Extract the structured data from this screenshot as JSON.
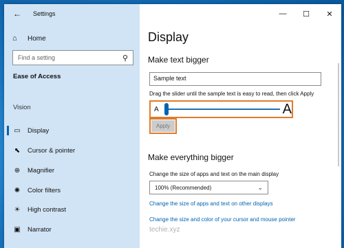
{
  "window": {
    "title": "Settings"
  },
  "controls": {
    "minimize": "—",
    "maximize": "☐",
    "close": "✕"
  },
  "sidebar": {
    "back_icon": "←",
    "home_label": "Home",
    "home_icon": "⌂",
    "search_placeholder": "Find a setting",
    "search_icon": "⚲",
    "section": "Ease of Access",
    "group": "Vision",
    "items": [
      {
        "label": "Display",
        "icon": "▭",
        "selected": true
      },
      {
        "label": "Cursor & pointer",
        "icon": "⬉"
      },
      {
        "label": "Magnifier",
        "icon": "⊕"
      },
      {
        "label": "Color filters",
        "icon": "✺"
      },
      {
        "label": "High contrast",
        "icon": "☀"
      },
      {
        "label": "Narrator",
        "icon": "▣"
      }
    ]
  },
  "main": {
    "title": "Display",
    "text_bigger": {
      "heading": "Make text bigger",
      "sample_value": "Sample text",
      "hint": "Drag the slider until the sample text is easy to read, then click Apply",
      "slider_min_label": "A",
      "slider_max_label": "A",
      "slider_level": 0.0,
      "apply_label": "Apply"
    },
    "everything_bigger": {
      "heading": "Make everything bigger",
      "size_label": "Change the size of apps and text on the main display",
      "size_value": "100% (Recommended)",
      "dropdown_icon": "⌄",
      "link_other_displays": "Change the size of apps and text on other displays",
      "link_cursor": "Change the size and color of your cursor and mouse pointer"
    },
    "watermark": "techie.xyz"
  },
  "colors": {
    "accent": "#0063b1",
    "highlight_border": "#e07b2a"
  }
}
